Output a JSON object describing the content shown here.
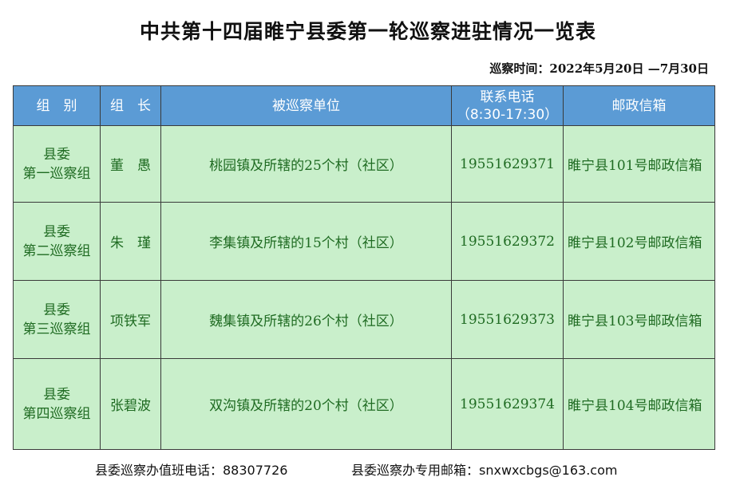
{
  "title": "中共第十四届睢宁县委第一轮巡察进驻情况一览表",
  "period": "巡察时间：2022年5月20日 —7月30日",
  "columns": [
    "组　别",
    "组　长",
    "被巡察单位",
    "联系电话",
    "（8:30-17:30）",
    "邮政信箱"
  ],
  "rows": [
    {
      "group_l1": "县委",
      "group_l2": "第一巡察组",
      "leader": "董　愚",
      "unit": "桃园镇及所辖的25个村（社区）",
      "phone": "19551629371",
      "mailbox": "睢宁县101号邮政信箱"
    },
    {
      "group_l1": "县委",
      "group_l2": "第二巡察组",
      "leader": "朱　瑾",
      "unit": "李集镇及所辖的15个村（社区）",
      "phone": "19551629372",
      "mailbox": "睢宁县102号邮政信箱"
    },
    {
      "group_l1": "县委",
      "group_l2": "第三巡察组",
      "leader": "项铁军",
      "unit": "魏集镇及所辖的26个村（社区）",
      "phone": "19551629373",
      "mailbox": "睢宁县103号邮政信箱"
    },
    {
      "group_l1": "县委",
      "group_l2": "第四巡察组",
      "leader": "张碧波",
      "unit": "双沟镇及所辖的20个村（社区）",
      "phone": "19551629374",
      "mailbox": "睢宁县104号邮政信箱"
    }
  ],
  "footer": {
    "hotline": "县委巡察办值班电话：88307726",
    "email": "县委巡察办专用邮箱：snxwxcbgs@163.com"
  },
  "colors": {
    "header_bg": "#5b9bd5",
    "cell_bg": "#c9efcb",
    "cell_text": "#1f6b22"
  }
}
